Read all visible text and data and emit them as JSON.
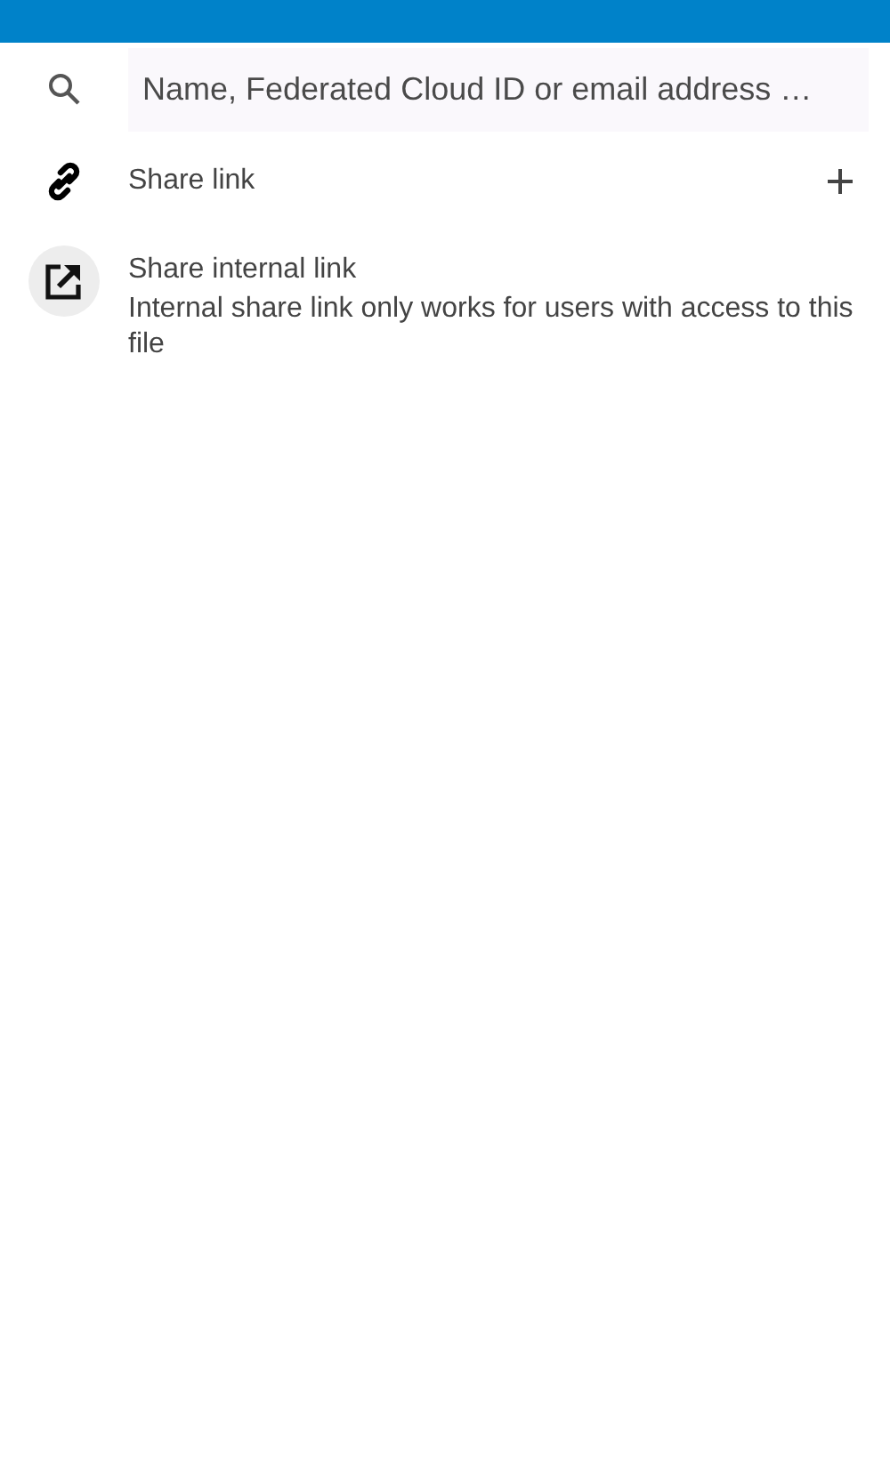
{
  "search": {
    "placeholder": "Name, Federated Cloud ID or email address …"
  },
  "share_link": {
    "label": "Share link"
  },
  "internal_link": {
    "title": "Share internal link",
    "description": "Internal share link only works for users with access to this file"
  }
}
